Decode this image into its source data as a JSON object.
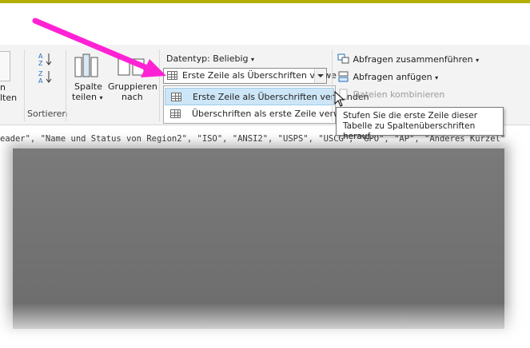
{
  "ribbon": {
    "left_partial_1": "n",
    "left_partial_2": "lten",
    "sort_group_label": "Sortieren",
    "split_column": {
      "line1": "Spalte",
      "line2": "teilen",
      "caret": "▾"
    },
    "group_by": {
      "line1": "Gruppieren",
      "line2": "nach"
    },
    "datatype_label": "Datentyp: Beliebig",
    "datatype_caret": "▾",
    "first_row_combo_text": "Erste Zeile als Überschriften verwe",
    "merge_queries": "Abfragen zusammenführen",
    "merge_caret": "▾",
    "append_queries": "Abfragen anfügen",
    "append_caret": "▾",
    "combine_files": "Dateien kombinieren"
  },
  "menu": {
    "items": [
      {
        "label": "Erste Zeile als Überschriften verwenden"
      },
      {
        "label": "Überschriften als erste Zeile verwenden"
      }
    ]
  },
  "tooltip": {
    "line1": "Stufen Sie die erste Zeile dieser",
    "line2": "Tabelle zu Spaltenüberschriften herauf."
  },
  "formula": {
    "text": "eader\", \"Name und Status von Region2\", \"ISO\", \"ANSI2\", \"USPS\", \"USCG\", \"GPO\", \"AP\", \"Anderes Kürzel\""
  },
  "colors": {
    "highlight": "#cde6f7",
    "arrow": "#ff22d4",
    "top_strip": "#b3ae00"
  }
}
